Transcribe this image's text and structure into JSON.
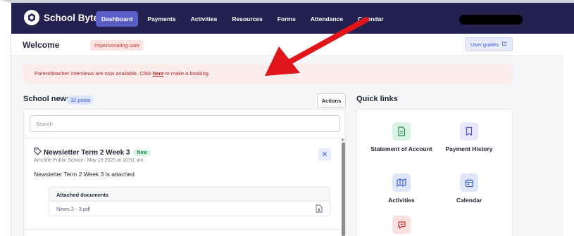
{
  "brand": {
    "name": "School Bytes",
    "logo_icon": "school-bytes-logo-icon"
  },
  "nav": {
    "items": [
      {
        "label": "Dashboard",
        "active": true
      },
      {
        "label": "Payments",
        "active": false
      },
      {
        "label": "Activities",
        "active": false
      },
      {
        "label": "Resources",
        "active": false
      },
      {
        "label": "Forms",
        "active": false
      },
      {
        "label": "Attendance",
        "active": false
      },
      {
        "label": "Calendar",
        "active": false
      }
    ]
  },
  "header": {
    "title": "Welcome",
    "impersonating_badge": "Impersonating user",
    "user_guides_label": "User guides"
  },
  "alert": {
    "text_before": "Parent/teacher interviews are now available. Click ",
    "link_text": "here",
    "text_after": " to make a booking."
  },
  "news": {
    "title": "School news",
    "count": "32 posts",
    "actions_label": "Actions",
    "search_placeholder": "Search",
    "post": {
      "title": "Newsletter Term 2 Week 3",
      "badge": "New",
      "meta": "Arncliffe Public School - May 19 2025 at 10:51 am",
      "body": "Newsletter Term 2 Week 3 is attached",
      "attachments_heading": "Attached documents",
      "attachments": [
        "News 2 - 3.pdf"
      ]
    }
  },
  "quick_links": {
    "title": "Quick links",
    "items": [
      {
        "label": "Statement of Account",
        "icon": "document-icon",
        "color": "#1e8a4a"
      },
      {
        "label": "Payment History",
        "icon": "bookmark-icon",
        "color": "#5a4fcf"
      },
      {
        "label": "Activities",
        "icon": "map-icon",
        "color": "#3656d6"
      },
      {
        "label": "Calendar",
        "icon": "calendar-icon",
        "color": "#3656d6"
      },
      {
        "label": "",
        "icon": "chat-icon",
        "color": "#d0322d"
      }
    ]
  },
  "colors": {
    "nav_bg": "#24204f",
    "nav_active": "#5a5fc7",
    "alert_bg": "#fdecec",
    "arrow": "#e0161b"
  }
}
